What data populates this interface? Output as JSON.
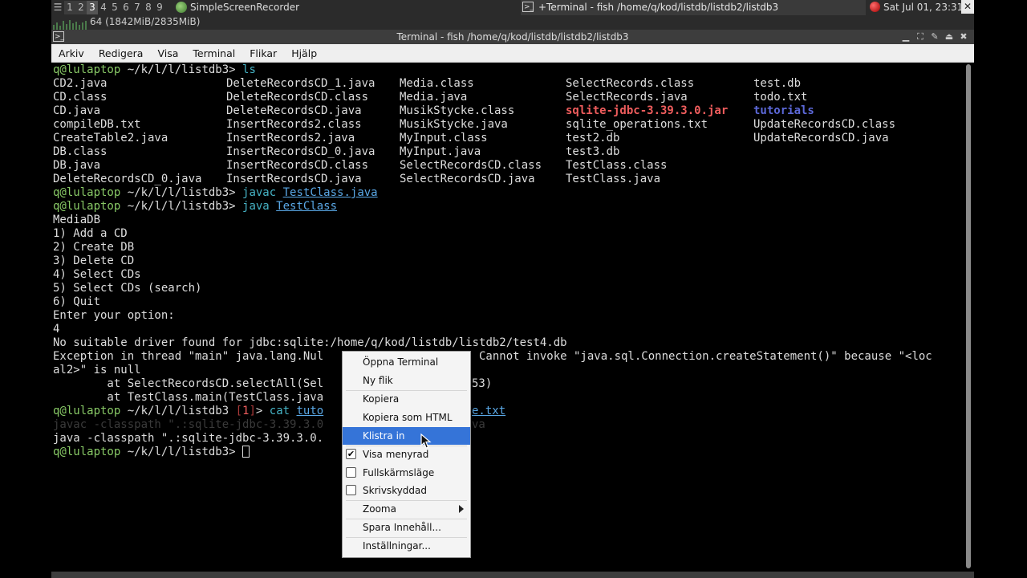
{
  "panel": {
    "workspaces": [
      "1",
      "2",
      "3",
      "4",
      "5",
      "6",
      "7",
      "8",
      "9"
    ],
    "active_workspace": "3",
    "app_name": "SimpleScreenRecorder",
    "memory": "64 (1842MiB/2835MiB)",
    "task_title": "+Terminal - fish /home/q/kod/listdb/listdb2/listdb3",
    "clock": "Sat Jul 01, 23:31",
    "icons": [
      "terminal-icon",
      "recorder-icon",
      "record-dot-icon",
      "close-icon"
    ]
  },
  "window": {
    "title": "Terminal - fish /home/q/kod/listdb/listdb2/listdb3"
  },
  "menubar": [
    "Arkiv",
    "Redigera",
    "Visa",
    "Terminal",
    "Flikar",
    "Hjälp"
  ],
  "terminal": {
    "prompt": {
      "user_host": "q@lulaptop",
      "path": " ~/k/l/l/listdb3",
      "gt": "> "
    },
    "cmd_ls": "ls",
    "ls_columns": [
      [
        "CD2.java",
        "CD.class",
        "CD.java",
        "compileDB.txt",
        "CreateTable2.java",
        "DB.class",
        "DB.java",
        "DeleteRecordsCD_0.java"
      ],
      [
        "DeleteRecordsCD_1.java",
        "DeleteRecordsCD.class",
        "DeleteRecordsCD.java",
        "InsertRecords2.class",
        "InsertRecords2.java",
        "InsertRecordsCD_0.java",
        "InsertRecordsCD.class",
        "InsertRecordsCD.java"
      ],
      [
        "Media.class",
        "Media.java",
        "MusikStycke.class",
        "MusikStycke.java",
        "MyInput.class",
        "MyInput.java",
        "SelectRecordsCD.class",
        "SelectRecordsCD.java"
      ],
      [
        "SelectRecords.class",
        "SelectRecords.java",
        "sqlite-jdbc-3.39.3.0.jar",
        "sqlite_operations.txt",
        "test2.db",
        "test3.db",
        "TestClass.class",
        "TestClass.java"
      ],
      [
        "test.db",
        "todo.txt",
        "tutorials",
        "UpdateRecordsCD.class",
        "UpdateRecordsCD.java"
      ]
    ],
    "cmd_javac": "javac",
    "arg_javac": "TestClass.java",
    "cmd_java": "java",
    "arg_java": "TestClass",
    "output": [
      "MediaDB",
      "1) Add a CD",
      "2) Create DB",
      "3) Delete CD",
      "4) Select CDs",
      "5) Select CDs (search)",
      "6) Quit",
      "Enter your option:",
      "4",
      "No suitable driver found for jdbc:sqlite:/home/q/kod/listdb/listdb2/test4.db"
    ],
    "exception_start": "Exception in thread \"main\" java.lang.Nul",
    "exception_end": "Cannot invoke \"java.sql.Connection.createStatement()\" because \"<loc",
    "exception_wrap": "al2>\" is null",
    "stack1_start": "        at SelectRecordsCD.selectAll(Sel",
    "stack1_end": "53)",
    "stack2_start": "        at TestClass.main(TestClass.java",
    "status_code": "1",
    "cmd_cat": "cat",
    "arg_cat_start": "tuto",
    "arg_cat_end": "e.txt",
    "suggestion_start": "javac -classpath \".:sqlite-jdbc-3.39.3.0",
    "suggestion_end": "va",
    "java_cp_line": "java -classpath \".:sqlite-jdbc-3.39.3.0."
  },
  "context_menu": {
    "items": [
      {
        "label": "Öppna Terminal"
      },
      {
        "label": "Ny flik"
      },
      {
        "label": "Kopiera"
      },
      {
        "label": "Kopiera som HTML"
      },
      {
        "label": "Klistra in",
        "highlighted": true
      },
      {
        "label": "Visa menyrad",
        "checked": true
      },
      {
        "label": "Fullskärmsläge",
        "checked": false
      },
      {
        "label": "Skrivskyddad",
        "checked": false
      },
      {
        "label": "Zooma",
        "submenu": true
      },
      {
        "label": "Spara Innehåll..."
      },
      {
        "label": "Inställningar..."
      }
    ]
  },
  "colors": {
    "highlight": "#3574d8",
    "prompt_user": "#88c966",
    "command": "#46b3c5",
    "link": "#5aa8e6",
    "jar": "#ef5d5d",
    "dir": "#5c68d8"
  }
}
